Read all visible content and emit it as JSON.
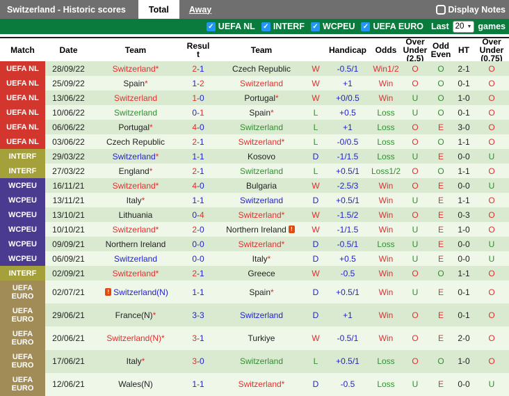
{
  "colors": {
    "tabbar_bg": "#6f6f6f",
    "filterbar_bg": "#0a7b3c",
    "checkbox_blue": "#2196f3",
    "text_red": "#e22f2f",
    "text_green": "#2f8f2f",
    "text_blue": "#2222cc",
    "row_dark": "#d9ead0",
    "row_light": "#eff7e8",
    "badge_colors": {
      "UEFA NL": "#d3362d",
      "INTERF": "#a4a13b",
      "WCPEU": "#4a3b90",
      "UEFA EURO": "#a18b57"
    }
  },
  "tabbar": {
    "title": "Switzerland - Historic scores",
    "tab_total": "Total",
    "tab_away": "Away",
    "display_notes_label": "Display Notes"
  },
  "filterbar": {
    "competitions": [
      "UEFA NL",
      "INTERF",
      "WCPEU",
      "UEFA EURO"
    ],
    "check_glyph": "✓",
    "last_label": "Last",
    "games_count": "20",
    "games_label": "games"
  },
  "table": {
    "headers": [
      "Match",
      "Date",
      "Team",
      "Result",
      "Team",
      "",
      "Handicap",
      "Odds",
      "Over Under (2.5)",
      "Odd Even",
      "HT",
      "Over Under (0.75)"
    ],
    "rows": [
      {
        "comp": "UEFA NL",
        "date": "28/09/22",
        "home": {
          "name": "Switzerland",
          "star": true,
          "color": "red"
        },
        "score": "2-1",
        "away": {
          "name": "Czech Republic",
          "star": false,
          "color": "black"
        },
        "wdl": "W",
        "handicap": "-0.5/1",
        "odds": "Win1/2",
        "ou25": "O",
        "oddeven": "O",
        "ht": "2-1",
        "ou075": "O"
      },
      {
        "comp": "UEFA NL",
        "date": "25/09/22",
        "home": {
          "name": "Spain",
          "star": true,
          "color": "black"
        },
        "score": "1-2",
        "away": {
          "name": "Switzerland",
          "star": false,
          "color": "red"
        },
        "wdl": "W",
        "handicap": "+1",
        "odds": "Win",
        "ou25": "O",
        "oddeven": "O",
        "ht": "0-1",
        "ou075": "O"
      },
      {
        "comp": "UEFA NL",
        "date": "13/06/22",
        "home": {
          "name": "Switzerland",
          "star": false,
          "color": "red"
        },
        "score": "1-0",
        "away": {
          "name": "Portugal",
          "star": true,
          "color": "black"
        },
        "wdl": "W",
        "handicap": "+0/0.5",
        "odds": "Win",
        "ou25": "U",
        "oddeven": "O",
        "ht": "1-0",
        "ou075": "O"
      },
      {
        "comp": "UEFA NL",
        "date": "10/06/22",
        "home": {
          "name": "Switzerland",
          "star": false,
          "color": "green"
        },
        "score": "0-1",
        "away": {
          "name": "Spain",
          "star": true,
          "color": "black"
        },
        "wdl": "L",
        "handicap": "+0.5",
        "odds": "Loss",
        "ou25": "U",
        "oddeven": "O",
        "ht": "0-1",
        "ou075": "O"
      },
      {
        "comp": "UEFA NL",
        "date": "06/06/22",
        "home": {
          "name": "Portugal",
          "star": true,
          "color": "black"
        },
        "score": "4-0",
        "away": {
          "name": "Switzerland",
          "star": false,
          "color": "green"
        },
        "wdl": "L",
        "handicap": "+1",
        "odds": "Loss",
        "ou25": "O",
        "oddeven": "E",
        "ht": "3-0",
        "ou075": "O"
      },
      {
        "comp": "UEFA NL",
        "date": "03/06/22",
        "home": {
          "name": "Czech Republic",
          "star": false,
          "color": "black"
        },
        "score": "2-1",
        "away": {
          "name": "Switzerland",
          "star": true,
          "color": "red"
        },
        "wdl": "L",
        "handicap": "-0/0.5",
        "odds": "Loss",
        "ou25": "O",
        "oddeven": "O",
        "ht": "1-1",
        "ou075": "O"
      },
      {
        "comp": "INTERF",
        "date": "29/03/22",
        "home": {
          "name": "Switzerland",
          "star": true,
          "color": "blue"
        },
        "score": "1-1",
        "away": {
          "name": "Kosovo",
          "star": false,
          "color": "black"
        },
        "wdl": "D",
        "handicap": "-1/1.5",
        "odds": "Loss",
        "ou25": "U",
        "oddeven": "E",
        "ht": "0-0",
        "ou075": "U"
      },
      {
        "comp": "INTERF",
        "date": "27/03/22",
        "home": {
          "name": "England",
          "star": true,
          "color": "black"
        },
        "score": "2-1",
        "away": {
          "name": "Switzerland",
          "star": false,
          "color": "green"
        },
        "wdl": "L",
        "handicap": "+0.5/1",
        "odds": "Loss1/2",
        "ou25": "O",
        "oddeven": "O",
        "ht": "1-1",
        "ou075": "O"
      },
      {
        "comp": "WCPEU",
        "date": "16/11/21",
        "home": {
          "name": "Switzerland",
          "star": true,
          "color": "red"
        },
        "score": "4-0",
        "away": {
          "name": "Bulgaria",
          "star": false,
          "color": "black"
        },
        "wdl": "W",
        "handicap": "-2.5/3",
        "odds": "Win",
        "ou25": "O",
        "oddeven": "E",
        "ht": "0-0",
        "ou075": "U"
      },
      {
        "comp": "WCPEU",
        "date": "13/11/21",
        "home": {
          "name": "Italy",
          "star": true,
          "color": "black"
        },
        "score": "1-1",
        "away": {
          "name": "Switzerland",
          "star": false,
          "color": "blue"
        },
        "wdl": "D",
        "handicap": "+0.5/1",
        "odds": "Win",
        "ou25": "U",
        "oddeven": "E",
        "ht": "1-1",
        "ou075": "O"
      },
      {
        "comp": "WCPEU",
        "date": "13/10/21",
        "home": {
          "name": "Lithuania",
          "star": false,
          "color": "black"
        },
        "score": "0-4",
        "away": {
          "name": "Switzerland",
          "star": true,
          "color": "red"
        },
        "wdl": "W",
        "handicap": "-1.5/2",
        "odds": "Win",
        "ou25": "O",
        "oddeven": "E",
        "ht": "0-3",
        "ou075": "O"
      },
      {
        "comp": "WCPEU",
        "date": "10/10/21",
        "home": {
          "name": "Switzerland",
          "star": true,
          "color": "red"
        },
        "score": "2-0",
        "away": {
          "name": "Northern Ireland",
          "star": false,
          "color": "black",
          "icon": "after"
        },
        "wdl": "W",
        "handicap": "-1/1.5",
        "odds": "Win",
        "ou25": "U",
        "oddeven": "E",
        "ht": "1-0",
        "ou075": "O"
      },
      {
        "comp": "WCPEU",
        "date": "09/09/21",
        "home": {
          "name": "Northern Ireland",
          "star": false,
          "color": "black"
        },
        "score": "0-0",
        "away": {
          "name": "Switzerland",
          "star": true,
          "color": "red"
        },
        "wdl": "D",
        "handicap": "-0.5/1",
        "odds": "Loss",
        "ou25": "U",
        "oddeven": "E",
        "ht": "0-0",
        "ou075": "U"
      },
      {
        "comp": "WCPEU",
        "date": "06/09/21",
        "home": {
          "name": "Switzerland",
          "star": false,
          "color": "blue"
        },
        "score": "0-0",
        "away": {
          "name": "Italy",
          "star": true,
          "color": "black"
        },
        "wdl": "D",
        "handicap": "+0.5",
        "odds": "Win",
        "ou25": "U",
        "oddeven": "E",
        "ht": "0-0",
        "ou075": "U"
      },
      {
        "comp": "INTERF",
        "date": "02/09/21",
        "home": {
          "name": "Switzerland",
          "star": true,
          "color": "red"
        },
        "score": "2-1",
        "away": {
          "name": "Greece",
          "star": false,
          "color": "black"
        },
        "wdl": "W",
        "handicap": "-0.5",
        "odds": "Win",
        "ou25": "O",
        "oddeven": "O",
        "ht": "1-1",
        "ou075": "O"
      },
      {
        "comp": "UEFA EURO",
        "date": "02/07/21",
        "home": {
          "name": "Switzerland(N)",
          "star": false,
          "color": "blue",
          "icon": "before"
        },
        "score": "1-1",
        "away": {
          "name": "Spain",
          "star": true,
          "color": "black"
        },
        "wdl": "D",
        "handicap": "+0.5/1",
        "odds": "Win",
        "ou25": "U",
        "oddeven": "E",
        "ht": "0-1",
        "ou075": "O"
      },
      {
        "comp": "UEFA EURO",
        "date": "29/06/21",
        "home": {
          "name": "France(N)",
          "star": true,
          "color": "black"
        },
        "score": "3-3",
        "away": {
          "name": "Switzerland",
          "star": false,
          "color": "blue"
        },
        "wdl": "D",
        "handicap": "+1",
        "odds": "Win",
        "ou25": "O",
        "oddeven": "E",
        "ht": "0-1",
        "ou075": "O"
      },
      {
        "comp": "UEFA EURO",
        "date": "20/06/21",
        "home": {
          "name": "Switzerland(N)",
          "star": true,
          "color": "red"
        },
        "score": "3-1",
        "away": {
          "name": "Turkiye",
          "star": false,
          "color": "black"
        },
        "wdl": "W",
        "handicap": "-0.5/1",
        "odds": "Win",
        "ou25": "O",
        "oddeven": "E",
        "ht": "2-0",
        "ou075": "O"
      },
      {
        "comp": "UEFA EURO",
        "date": "17/06/21",
        "home": {
          "name": "Italy",
          "star": true,
          "color": "black"
        },
        "score": "3-0",
        "away": {
          "name": "Switzerland",
          "star": false,
          "color": "green"
        },
        "wdl": "L",
        "handicap": "+0.5/1",
        "odds": "Loss",
        "ou25": "O",
        "oddeven": "O",
        "ht": "1-0",
        "ou075": "O"
      },
      {
        "comp": "UEFA EURO",
        "date": "12/06/21",
        "home": {
          "name": "Wales(N)",
          "star": false,
          "color": "black"
        },
        "score": "1-1",
        "away": {
          "name": "Switzerland",
          "star": true,
          "color": "red"
        },
        "wdl": "D",
        "handicap": "-0.5",
        "odds": "Loss",
        "ou25": "U",
        "oddeven": "E",
        "ht": "0-0",
        "ou075": "U"
      }
    ]
  }
}
